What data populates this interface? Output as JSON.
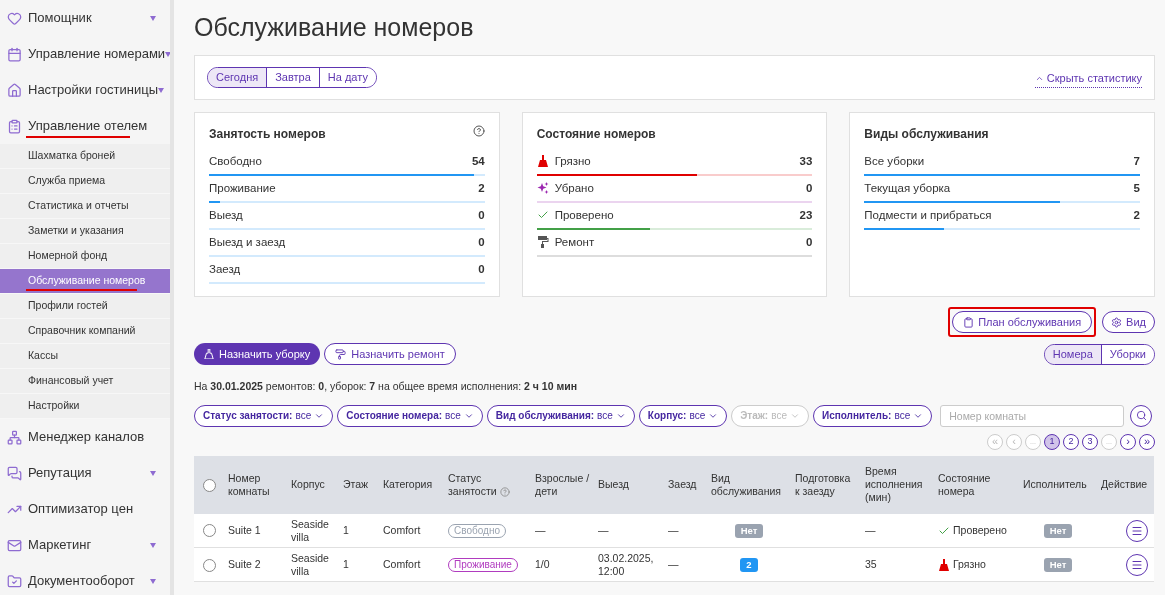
{
  "sidebar": {
    "items": [
      {
        "label": "Помощник",
        "caret": true
      },
      {
        "label": "Управление номерами",
        "caret": true
      },
      {
        "label": "Настройки гостиницы",
        "caret": true
      },
      {
        "label": "Управление отелем",
        "caret": false,
        "highlighted": true,
        "children": [
          {
            "label": "Шахматка броней",
            "selected": false
          },
          {
            "label": "Служба приема",
            "selected": false
          },
          {
            "label": "Статистика и отчеты",
            "selected": false
          },
          {
            "label": "Заметки и указания",
            "selected": false
          },
          {
            "label": "Номерной фонд",
            "selected": false
          },
          {
            "label": "Обслуживание номеров",
            "selected": true
          },
          {
            "label": "Профили гостей",
            "selected": false
          },
          {
            "label": "Справочник компаний",
            "selected": false
          },
          {
            "label": "Кассы",
            "selected": false
          },
          {
            "label": "Финансовый учет",
            "selected": false
          },
          {
            "label": "Настройки",
            "selected": false
          }
        ]
      },
      {
        "label": "Менеджер каналов",
        "caret": false
      },
      {
        "label": "Репутация",
        "caret": true
      },
      {
        "label": "Оптимизатор цен",
        "caret": false
      },
      {
        "label": "Маркетинг",
        "caret": true
      },
      {
        "label": "Документооборот",
        "caret": true
      }
    ]
  },
  "page_title": "Обслуживание номеров",
  "date_tabs": [
    {
      "label": "Сегодня",
      "selected": true
    },
    {
      "label": "Завтра",
      "selected": false
    },
    {
      "label": "На дату",
      "selected": false
    }
  ],
  "hide_stats_link": "Скрыть статистику",
  "stat_cards": [
    {
      "title": "Занятость номеров",
      "help": true,
      "rows": [
        {
          "label": "Свободно",
          "value": "54",
          "level": 0.96,
          "color": "#2196f3"
        },
        {
          "label": "Проживание",
          "value": "2",
          "level": 0.04,
          "color": "#2196f3"
        },
        {
          "label": "Выезд",
          "value": "0"
        },
        {
          "label": "Выезд и заезд",
          "value": "0"
        },
        {
          "label": "Заезд",
          "value": "0"
        }
      ]
    },
    {
      "title": "Состояние номеров",
      "help": false,
      "rows": [
        {
          "label": "Грязно",
          "value": "33",
          "level": 0.58,
          "color": "#e00000",
          "kind": "dirty"
        },
        {
          "label": "Убрано",
          "value": "0",
          "color": "#9c27b0",
          "kind": "cleaned"
        },
        {
          "label": "Проверено",
          "value": "23",
          "level": 0.41,
          "color": "#43a047",
          "kind": "checked"
        },
        {
          "label": "Ремонт",
          "value": "0",
          "color": "#555555",
          "kind": "repair"
        }
      ]
    },
    {
      "title": "Виды обслуживания",
      "help": false,
      "rows": [
        {
          "label": "Все уборки",
          "value": "7",
          "level": 1,
          "color": "#2196f3"
        },
        {
          "label": "Текущая уборка",
          "value": "5",
          "level": 0.71,
          "color": "#2196f3"
        },
        {
          "label": "Подмести и прибраться",
          "value": "2",
          "level": 0.29,
          "color": "#2196f3"
        }
      ]
    }
  ],
  "plan_button": "План обслуживания",
  "view_button": "Вид",
  "assign_cleaning_button": "Назначить уборку",
  "assign_repair_button": "Назначить ремонт",
  "mode_tabs": [
    {
      "label": "Номера",
      "selected": true
    },
    {
      "label": "Уборки",
      "selected": false
    }
  ],
  "summary": "На **30.01.2025** ремонтов: **0**, уборок: **7** на общее время исполнения: **2 ч 10 мин**",
  "filters": [
    {
      "label": "Статус занятости:",
      "value": "все",
      "disabled": false
    },
    {
      "label": "Состояние номера:",
      "value": "все",
      "disabled": false
    },
    {
      "label": "Вид обслуживания:",
      "value": "все",
      "disabled": false
    },
    {
      "label": "Корпус:",
      "value": "все",
      "disabled": false
    },
    {
      "label": "Этаж:",
      "value": "все",
      "disabled": true
    },
    {
      "label": "Исполнитель:",
      "value": "все",
      "disabled": false
    }
  ],
  "room_search": {
    "placeholder": "Номер комнаты"
  },
  "pager": [
    {
      "label": "«",
      "kind": "nav",
      "disabled": true,
      "selected": false
    },
    {
      "label": "‹",
      "kind": "nav",
      "disabled": true,
      "selected": false
    },
    {
      "label": "...",
      "kind": "gap",
      "disabled": true,
      "selected": false
    },
    {
      "label": "1",
      "kind": "page",
      "disabled": false,
      "selected": true
    },
    {
      "label": "2",
      "kind": "page",
      "disabled": false,
      "selected": false
    },
    {
      "label": "3",
      "kind": "page",
      "disabled": false,
      "selected": false
    },
    {
      "label": "...",
      "kind": "gap",
      "disabled": true,
      "selected": false
    },
    {
      "label": "›",
      "kind": "nav",
      "disabled": false,
      "selected": false
    },
    {
      "label": "»",
      "kind": "nav",
      "disabled": false,
      "selected": false
    }
  ],
  "table": {
    "select_all_checked": false,
    "columns": [
      "Номер комнаты",
      "Корпус",
      "Этаж",
      "Категория",
      "Статус занятости",
      "Взрослые / дети",
      "Выезд",
      "Заезд",
      "Вид обслуживания",
      "Подготовка к заезду",
      "Время исполнения (мин)",
      "Состояние номера",
      "Исполнитель",
      "Действие"
    ],
    "rows": [
      {
        "checked": false,
        "room": "Suite 1",
        "building": "Seaside villa",
        "floor": "1",
        "category": "Comfort",
        "status": {
          "label": "Свободно",
          "kind": "free"
        },
        "guests": "—",
        "departure": "—",
        "arrival": "—",
        "service": {
          "label": "Нет",
          "color": "#9aa3b0"
        },
        "time": "—",
        "state": {
          "label": "Проверено",
          "kind": "checked"
        },
        "executor": "Нет"
      },
      {
        "checked": false,
        "room": "Suite 2",
        "building": "Seaside villa",
        "floor": "1",
        "category": "Comfort",
        "status": {
          "label": "Проживание",
          "kind": "living"
        },
        "guests": "1/0",
        "departure": "03.02.2025, 12:00",
        "arrival": "—",
        "service": {
          "label": "2",
          "color": "#2196f3"
        },
        "time": "35",
        "state": {
          "label": "Грязно",
          "kind": "dirty"
        },
        "executor": "Нет"
      }
    ]
  }
}
